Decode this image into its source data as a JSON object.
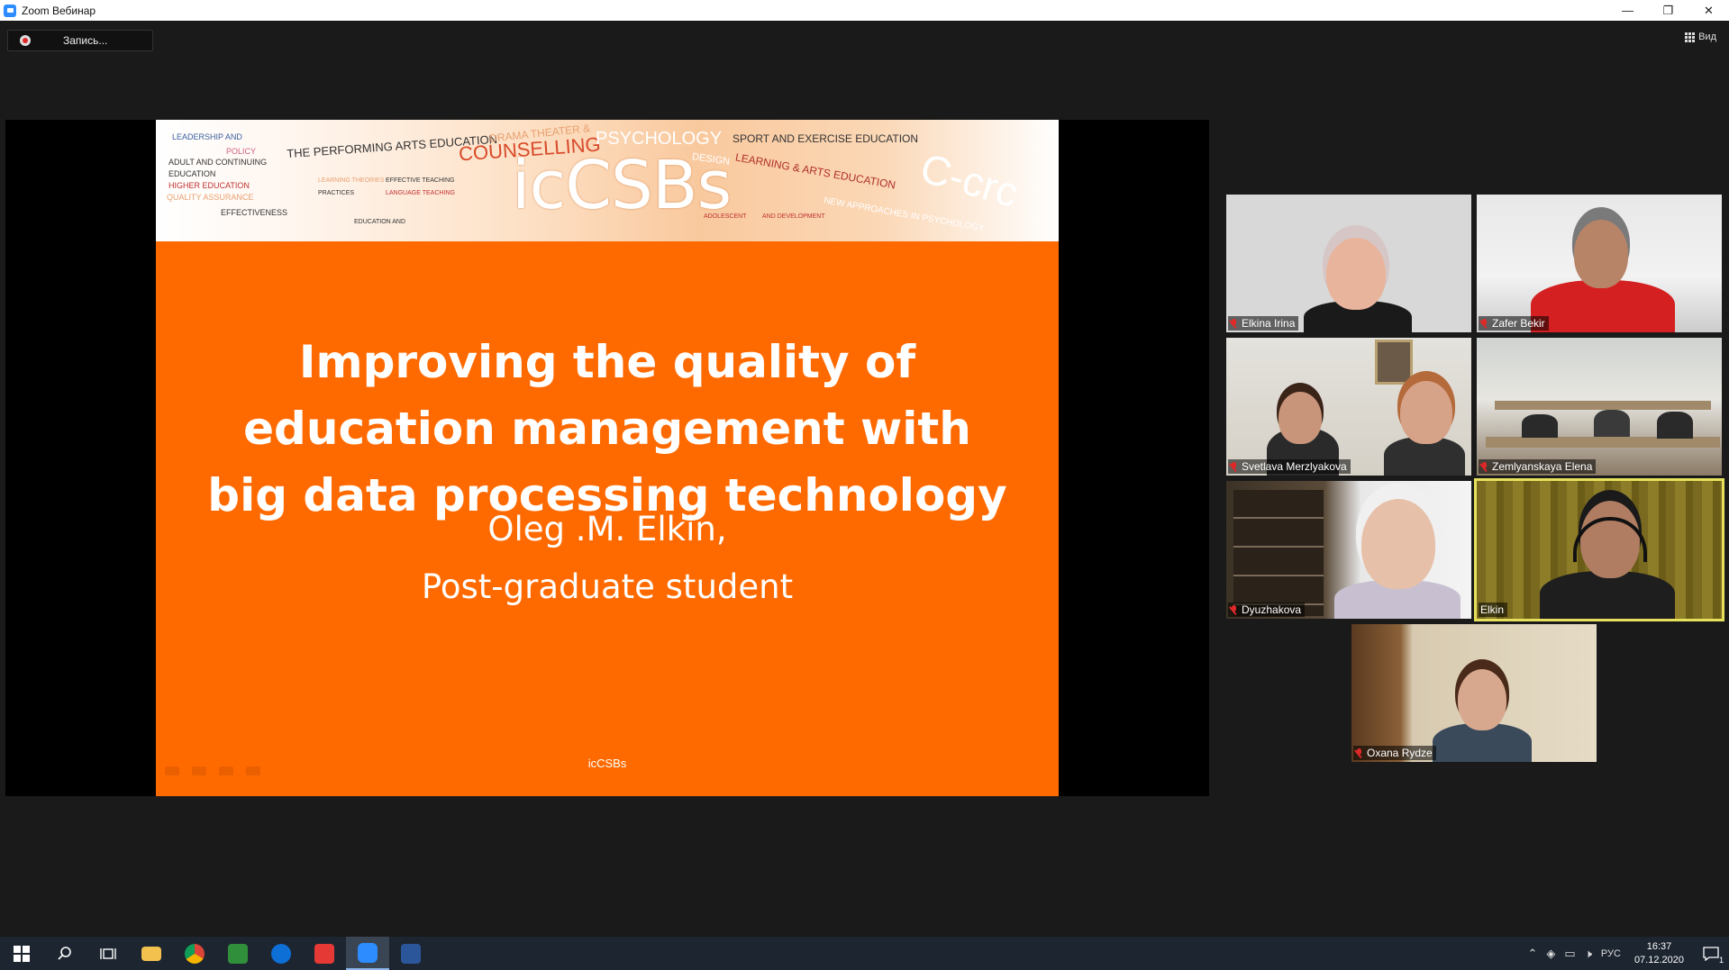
{
  "window": {
    "title": "Zoom Вебинар",
    "controls": {
      "minimize": "—",
      "restore": "❐",
      "close": "✕"
    }
  },
  "toolbar": {
    "record_label": "Запись...",
    "view_label": "Вид"
  },
  "slide": {
    "banner_title": "icCSBs",
    "banner_words": [
      "LEADERSHIP AND",
      "POLICY",
      "ADULT AND CONTINUING",
      "EDUCATION",
      "HIGHER EDUCATION",
      "QUALITY ASSURANCE",
      "EFFECTIVENESS",
      "THE PERFORMING ARTS EDUCATION",
      "DRAMA THEATER &",
      "COUNSELLING",
      "PSYCHOLOGY",
      "SPORT AND EXERCISE EDUCATION",
      "DESIGN",
      "LEARNING & ARTS EDUCATION",
      "LEARNING THEORIES",
      "EFFECTIVE TEACHING",
      "PRACTICES",
      "LANGUAGE TEACHING",
      "EDUCATION AND",
      "NEW APPROACHES IN PSYCHOLOGY",
      "ADOLESCENT",
      "AND DEVELOPMENT",
      "C-crc"
    ],
    "heading_lines": [
      "Improving the quality of",
      "education management with",
      "big data processing technology"
    ],
    "author": "Oleg .M. Elkin,",
    "role": "Post-graduate student",
    "footer": "icCSBs"
  },
  "participants": [
    {
      "name": "Elkina Irina",
      "muted": true
    },
    {
      "name": "Zafer Bekir",
      "muted": true
    },
    {
      "name": "Svetlava Merzlyakova",
      "muted": true
    },
    {
      "name": "Zemlyanskaya Elena",
      "muted": true
    },
    {
      "name": "Dyuzhakova",
      "muted": true
    },
    {
      "name": "Elkin",
      "muted": false,
      "active_speaker": true
    },
    {
      "name": "Oxana Rydze",
      "muted": true
    }
  ],
  "taskbar": {
    "language": "РУС",
    "time": "16:37",
    "date": "07.12.2020",
    "notification_count": "1",
    "apps": [
      "start",
      "search",
      "task-view",
      "file-explorer",
      "chrome",
      "excel-like",
      "teamviewer",
      "anydesk",
      "zoom",
      "word"
    ]
  },
  "colors": {
    "slide_orange": "#ff6a00",
    "active_speaker_border": "#e6e15c",
    "muted_red": "#e02828",
    "zoom_blue": "#2d8cff"
  }
}
